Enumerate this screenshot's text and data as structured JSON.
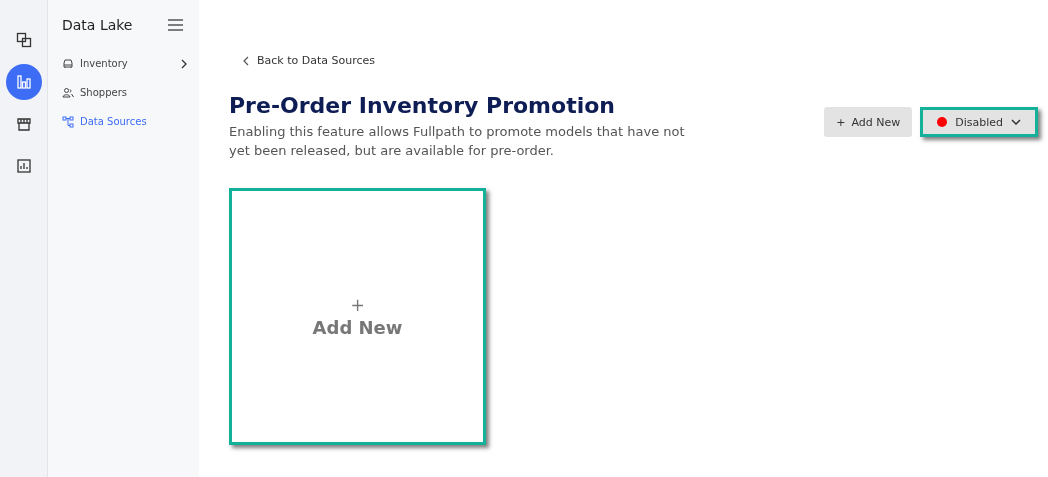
{
  "rail": [
    {
      "kind": "layers",
      "selected": false
    },
    {
      "kind": "bars",
      "selected": true
    },
    {
      "kind": "store",
      "selected": false
    },
    {
      "kind": "report",
      "selected": false
    }
  ],
  "sidebar": {
    "title": "Data Lake",
    "items": [
      {
        "kind": "car",
        "label": "Inventory",
        "selected": false,
        "expandable": true
      },
      {
        "kind": "people",
        "label": "Shoppers",
        "selected": false,
        "expandable": false
      },
      {
        "kind": "tree",
        "label": "Data Sources",
        "selected": true,
        "expandable": false
      }
    ]
  },
  "back_link": "Back to Data Sources",
  "title": "Pre-Order Inventory Promotion",
  "description": "Enabling this feature allows Fullpath to promote models that have not yet been released, but are available for pre-order.",
  "add_button": {
    "icon": "+",
    "label": "Add New"
  },
  "status_dropdown": {
    "label": "Disabled",
    "color": "#ff0000",
    "highlighted": true
  },
  "add_card": {
    "icon": "+",
    "label": "Add New",
    "highlighted": true
  }
}
